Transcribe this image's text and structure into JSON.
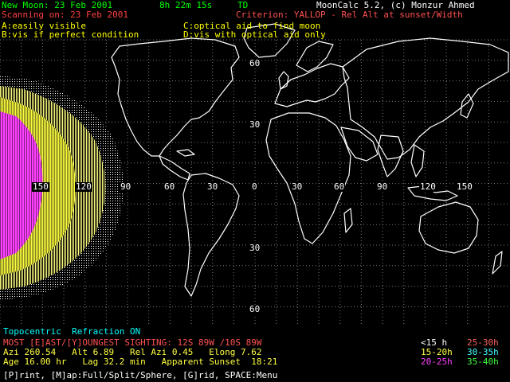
{
  "header": {
    "new_moon": "New Moon: 23 Feb 2001",
    "moon_age_time": "8h 22m 15s",
    "time_system": "TD",
    "scanning": "Scanning on: 23 Feb 2001",
    "program": "MoonCalc 5.2, (c) Monzur Ahmed",
    "criterion": "Criterion: YALLOP - Rel Alt at sunset/Width"
  },
  "legend": {
    "a": "A:easily visible",
    "b": "B:vis if perfect condition",
    "c": "C:optical aid to find moon",
    "d": "D:vis with optical aid only"
  },
  "longitude_labels": [
    "150",
    "120",
    "90",
    "60",
    "30",
    "0",
    "30",
    "60",
    "90",
    "120",
    "150"
  ],
  "latitude_labels": [
    "60",
    "30",
    "30",
    "60"
  ],
  "footer": {
    "topocentric": "Topocentric  Refraction ON",
    "most_sighting": "MOST [E]AST/[Y]OUNGEST SIGHTING: 12S 89W /10S 89W",
    "azi_line": "Azi 260.54   Alt 6.89   Rel Azi 0.45   Elong 7.62",
    "age_line": "Age 16.00 hr   Lag 32.2 min   Apparent Sunset  18:21",
    "menu": "[P]rint, [M]ap:Full/Split/Sphere, [G]rid, SPACE:Menu"
  },
  "age_key": {
    "k1": "<15 h",
    "k2": "25-30h",
    "k3": "15-20h",
    "k4": "30-35h",
    "k5": "20-25h",
    "k6": "35-40h"
  },
  "colors": {
    "header_green": "#00ff00",
    "scanning_red": "#ff4040",
    "criterion_red": "#ff5050",
    "legend_yellow": "#ffff00",
    "topocentric_cyan": "#00ffff",
    "sighting_red": "#ff5050",
    "stats_yellow": "#ffff40",
    "key_white": "#ffffff",
    "key_salmon": "#ff6060",
    "key_yellow": "#ffff40",
    "key_cyan": "#40ffff",
    "key_magenta": "#ff40ff",
    "key_green": "#40ff40",
    "visibility_a": "#ff40ff",
    "visibility_b": "#ffff40",
    "visibility_c": "#ffff80",
    "visibility_d": "#ffffff"
  }
}
